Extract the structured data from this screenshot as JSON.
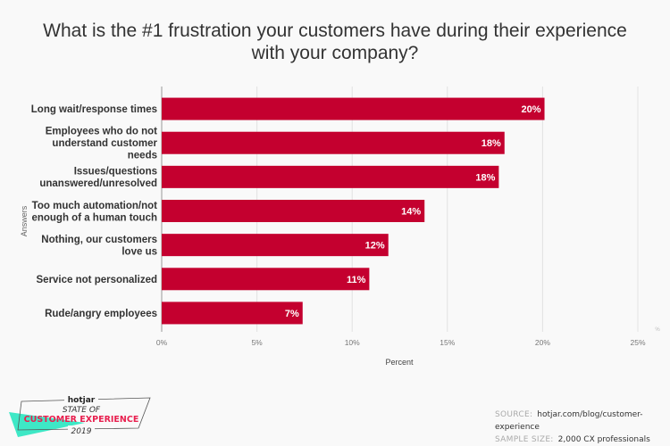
{
  "title_lines": [
    "What is the #1 frustration your customers have during their experience",
    "with your company?"
  ],
  "chart_data": {
    "type": "bar",
    "orientation": "horizontal",
    "title": "What is the #1 frustration your customers have during their experience with your company?",
    "xlabel": "Percent",
    "ylabel": "Answers",
    "xlim": [
      0,
      25
    ],
    "xticks": [
      "0%",
      "5%",
      "10%",
      "15%",
      "20%",
      "25%"
    ],
    "xtick_values": [
      0,
      5,
      10,
      15,
      20,
      25
    ],
    "extra_axis_label": "%",
    "grid": true,
    "bar_color": "#c4002f",
    "categories": [
      [
        "Long wait/response times"
      ],
      [
        "Employees who do not",
        "understand customer",
        "needs"
      ],
      [
        "Issues/questions",
        "unanswered/unresolved"
      ],
      [
        "Too much automation/not",
        "enough of a human touch"
      ],
      [
        "Nothing, our customers",
        "love us"
      ],
      [
        "Service not personalized"
      ],
      [
        "Rude/angry employees"
      ]
    ],
    "values": [
      20.1,
      18.0,
      17.7,
      13.8,
      11.9,
      10.9,
      7.4
    ],
    "data_labels": [
      "20%",
      "18%",
      "18%",
      "14%",
      "12%",
      "11%",
      "7%"
    ]
  },
  "badge": {
    "brand": "hotjar",
    "line1": "STATE OF",
    "line2": "CUSTOMER EXPERIENCE",
    "line3": "2019",
    "accent": "#e8204f",
    "teal": "#3ee8c6"
  },
  "footer": {
    "source_key": "SOURCE:",
    "source_val": "hotjar.com/blog/customer-experience",
    "sample_key": "SAMPLE SIZE:",
    "sample_val": "2,000 CX professionals"
  }
}
